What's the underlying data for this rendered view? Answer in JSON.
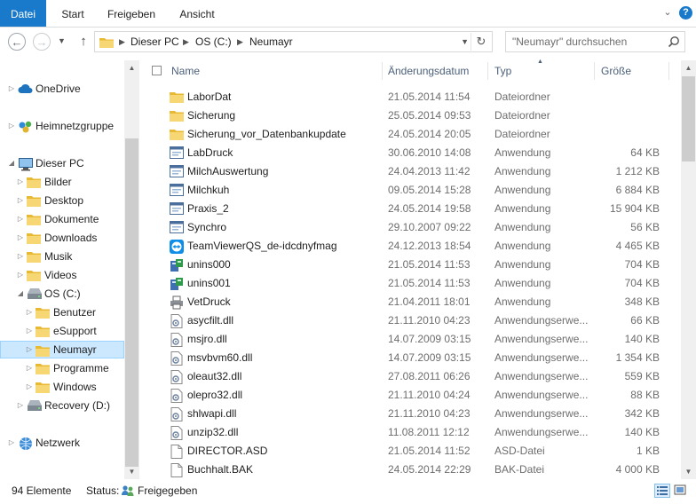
{
  "ribbon": {
    "tabs": [
      {
        "label": "Datei"
      },
      {
        "label": "Start"
      },
      {
        "label": "Freigeben"
      },
      {
        "label": "Ansicht"
      }
    ],
    "help_label": "?"
  },
  "address": {
    "breadcrumbs": [
      "Dieser PC",
      "OS (C:)",
      "Neumayr"
    ]
  },
  "search": {
    "placeholder": "\"Neumayr\" durchsuchen"
  },
  "nav_tree": [
    {
      "label": "OneDrive",
      "icon": "cloud-icon"
    },
    {
      "label": "Heimnetzgruppe",
      "icon": "homegroup-icon"
    },
    {
      "label": "Dieser PC",
      "icon": "computer-icon"
    },
    {
      "label": "Bilder",
      "icon": "folder-icon"
    },
    {
      "label": "Desktop",
      "icon": "folder-icon"
    },
    {
      "label": "Dokumente",
      "icon": "folder-icon"
    },
    {
      "label": "Downloads",
      "icon": "folder-icon"
    },
    {
      "label": "Musik",
      "icon": "folder-icon"
    },
    {
      "label": "Videos",
      "icon": "folder-icon"
    },
    {
      "label": "OS (C:)",
      "icon": "drive-icon"
    },
    {
      "label": "Benutzer",
      "icon": "folder-icon"
    },
    {
      "label": "eSupport",
      "icon": "folder-icon"
    },
    {
      "label": "Neumayr",
      "icon": "folder-icon"
    },
    {
      "label": "Programme",
      "icon": "folder-icon"
    },
    {
      "label": "Windows",
      "icon": "folder-icon"
    },
    {
      "label": "Recovery (D:)",
      "icon": "drive-icon"
    },
    {
      "label": "Netzwerk",
      "icon": "network-icon"
    }
  ],
  "columns": {
    "name": "Name",
    "date": "Änderungsdatum",
    "type": "Typ",
    "size": "Größe"
  },
  "files": [
    {
      "name": "LaborDat",
      "date": "21.05.2014 11:54",
      "type": "Dateiordner",
      "size": "",
      "icon": "folder-icon"
    },
    {
      "name": "Sicherung",
      "date": "25.05.2014 09:53",
      "type": "Dateiordner",
      "size": "",
      "icon": "folder-icon"
    },
    {
      "name": "Sicherung_vor_Datenbankupdate",
      "date": "24.05.2014 20:05",
      "type": "Dateiordner",
      "size": "",
      "icon": "folder-icon"
    },
    {
      "name": "LabDruck",
      "date": "30.06.2010 14:08",
      "type": "Anwendung",
      "size": "64 KB",
      "icon": "app-icon"
    },
    {
      "name": "MilchAuswertung",
      "date": "24.04.2013 11:42",
      "type": "Anwendung",
      "size": "1 212 KB",
      "icon": "app-icon"
    },
    {
      "name": "Milchkuh",
      "date": "09.05.2014 15:28",
      "type": "Anwendung",
      "size": "6 884 KB",
      "icon": "app-icon"
    },
    {
      "name": "Praxis_2",
      "date": "24.05.2014 19:58",
      "type": "Anwendung",
      "size": "15 904 KB",
      "icon": "app-icon"
    },
    {
      "name": "Synchro",
      "date": "29.10.2007 09:22",
      "type": "Anwendung",
      "size": "56 KB",
      "icon": "app-icon"
    },
    {
      "name": "TeamViewerQS_de-idcdnyfmag",
      "date": "24.12.2013 18:54",
      "type": "Anwendung",
      "size": "4 465 KB",
      "icon": "teamviewer-icon"
    },
    {
      "name": "unins000",
      "date": "21.05.2014 11:53",
      "type": "Anwendung",
      "size": "704 KB",
      "icon": "uninstall-icon"
    },
    {
      "name": "unins001",
      "date": "21.05.2014 11:53",
      "type": "Anwendung",
      "size": "704 KB",
      "icon": "uninstall-icon"
    },
    {
      "name": "VetDruck",
      "date": "21.04.2011 18:01",
      "type": "Anwendung",
      "size": "348 KB",
      "icon": "printer-icon"
    },
    {
      "name": "asycfilt.dll",
      "date": "21.11.2010 04:23",
      "type": "Anwendungserwe...",
      "size": "66 KB",
      "icon": "dll-icon"
    },
    {
      "name": "msjro.dll",
      "date": "14.07.2009 03:15",
      "type": "Anwendungserwe...",
      "size": "140 KB",
      "icon": "dll-icon"
    },
    {
      "name": "msvbvm60.dll",
      "date": "14.07.2009 03:15",
      "type": "Anwendungserwe...",
      "size": "1 354 KB",
      "icon": "dll-icon"
    },
    {
      "name": "oleaut32.dll",
      "date": "27.08.2011 06:26",
      "type": "Anwendungserwe...",
      "size": "559 KB",
      "icon": "dll-icon"
    },
    {
      "name": "olepro32.dll",
      "date": "21.11.2010 04:24",
      "type": "Anwendungserwe...",
      "size": "88 KB",
      "icon": "dll-icon"
    },
    {
      "name": "shlwapi.dll",
      "date": "21.11.2010 04:23",
      "type": "Anwendungserwe...",
      "size": "342 KB",
      "icon": "dll-icon"
    },
    {
      "name": "unzip32.dll",
      "date": "11.08.2011 12:12",
      "type": "Anwendungserwe...",
      "size": "140 KB",
      "icon": "dll-icon"
    },
    {
      "name": "DIRECTOR.ASD",
      "date": "21.05.2014 11:52",
      "type": "ASD-Datei",
      "size": "1 KB",
      "icon": "file-icon"
    },
    {
      "name": "Buchhalt.BAK",
      "date": "24.05.2014 22:29",
      "type": "BAK-Datei",
      "size": "4 000 KB",
      "icon": "file-icon"
    }
  ],
  "status": {
    "count": "94 Elemente",
    "status_label": "Status:",
    "shared": "Freigegeben"
  },
  "colors": {
    "accent": "#1979ca",
    "selection": "#cce8ff",
    "folder": "#f2c54d",
    "header_text": "#4c607a"
  }
}
